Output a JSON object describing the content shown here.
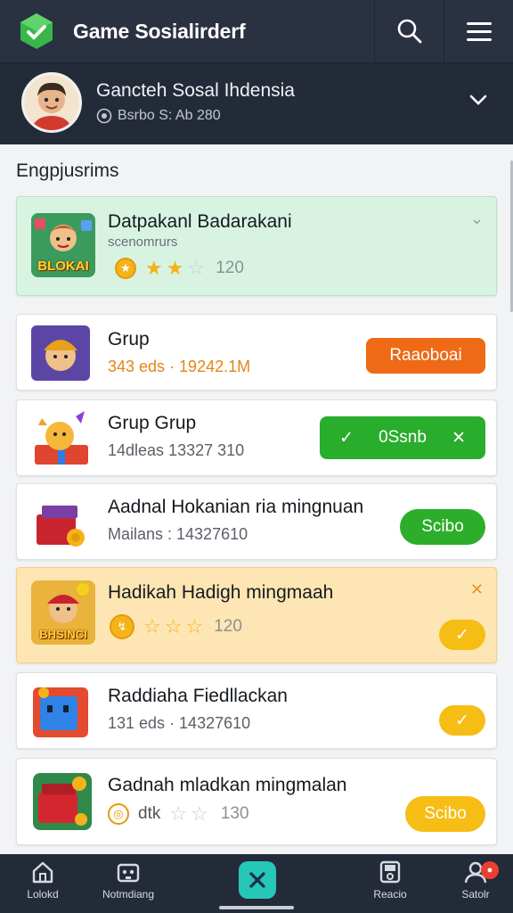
{
  "app": {
    "title": "Game Sosialirderf"
  },
  "profile": {
    "name": "Gancteh Sosal Ihdensia",
    "subtitle": "Bsrbo S: Ab 280"
  },
  "section": {
    "title": "Engpjusrims"
  },
  "cards": [
    {
      "title": "Datpakanl Badarakani",
      "subtitle": "scenomrurs",
      "rating": "120",
      "thumb_label": "BLOKAI"
    },
    {
      "title": "Grup",
      "subtitle": "343 eds · 19242.1M",
      "button": "Raaoboai"
    },
    {
      "title": "Grup Grup",
      "subtitle": "14dleas 13327 310",
      "button": "0Ssnb"
    },
    {
      "title": "Aadnal Hokanian ria mingnuan",
      "subtitle": "Mailans : 14327610",
      "button": "Scibo"
    },
    {
      "title": "Hadikah Hadigh mingmaah",
      "rating": "120",
      "thumb_label": "BHSINCI"
    },
    {
      "title": "Raddiaha Fiedllackan",
      "subtitle": "131 eds · 14327610"
    },
    {
      "title": "Gadnah mladkan mingmalan",
      "rating_prefix": "dtk",
      "rating": "130",
      "button": "Scibo"
    }
  ],
  "bottom_nav": [
    {
      "label": "Lolokd"
    },
    {
      "label": "Notmdiang"
    },
    {
      "label": ""
    },
    {
      "label": "Reacio"
    },
    {
      "label": "Satolr"
    }
  ],
  "colors": {
    "appbar": "#2a3140",
    "accent_green": "#2cae2a",
    "accent_orange": "#ef6a16",
    "accent_yellow": "#f6bd14",
    "teal": "#25c7b8"
  }
}
